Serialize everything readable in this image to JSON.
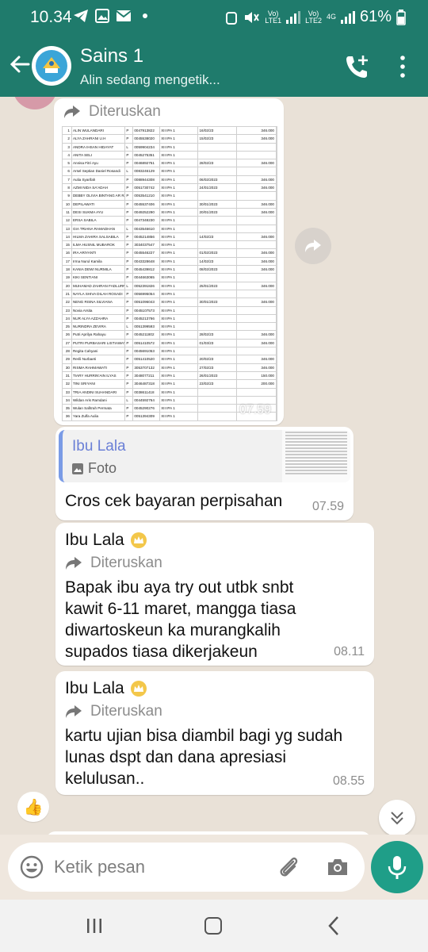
{
  "status_bar": {
    "time": "10.34",
    "battery": "61%",
    "lte1": "Vo)\nLTE1",
    "lte2": "Vo)\nLTE2",
    "network": "4G"
  },
  "header": {
    "title": "Sains 1",
    "subtitle": "Alin sedang mengetik..."
  },
  "messages": {
    "forwarded_label": "Diteruskan",
    "sheet_time": "07.59",
    "sheet_rows": [
      [
        "1",
        "ALIN WULANDARI",
        "P",
        "0047913822",
        "XII IPA 1",
        "16/02/23",
        "346.000"
      ],
      [
        "2",
        "ALYA ZAHRANI U.H",
        "P",
        "0045538020",
        "XII IPA 1",
        "15/02/23",
        "346.000"
      ],
      [
        "3",
        "ANDRA IHSAN HIDAYAT",
        "L",
        "0059904234",
        "XII IPA 1",
        "",
        ""
      ],
      [
        "4",
        "ANITA SELI",
        "P",
        "0045275351",
        "XII IPA 1",
        "",
        ""
      ],
      [
        "5",
        "Annisa Fitri Ayu",
        "P",
        "0046892751",
        "XII IPA 1",
        "28/02/23",
        "346.000"
      ],
      [
        "6",
        "Arsel Septian Daniel Rosandi",
        "L",
        "0083246129",
        "XII IPA 1",
        "",
        ""
      ],
      [
        "7",
        "Aulia Syarifah",
        "P",
        "0088944308",
        "XII IPA 1",
        "06/02/2023",
        "346.000"
      ],
      [
        "8",
        "AZMI NIDA SA'ADAH",
        "P",
        "0051730742",
        "XII IPA 1",
        "24/01/2023",
        "346.000"
      ],
      [
        "9",
        "DEBBY OLIVIA BINTANG AR RAFFA",
        "P",
        "0053541210",
        "XII IPA 1",
        "",
        ""
      ],
      [
        "10",
        "DEPILAWATI",
        "P",
        "0045537406",
        "XII IPA 1",
        "30/01/2023",
        "346.000"
      ],
      [
        "11",
        "DESI SUKMA AYU",
        "P",
        "0049252290",
        "XII IPA 1",
        "20/01/2023",
        "346.000"
      ],
      [
        "12",
        "ERSA SABILA",
        "P",
        "0047348230",
        "XII IPA 1",
        "",
        ""
      ],
      [
        "13",
        "GIA TRIANA RAMADHAN",
        "L",
        "0043546610",
        "XII IPA 1",
        "",
        ""
      ],
      [
        "14",
        "HILMA ZAHIRA SALSABILA",
        "P",
        "0045214856",
        "XII IPA 1",
        "14/02/23",
        "346.000"
      ],
      [
        "15",
        "ILMA HUSNIL MUBAROK",
        "P",
        "3034037547",
        "XII IPA 1",
        "",
        ""
      ],
      [
        "16",
        "IRA ARIYANTI",
        "P",
        "0045546227",
        "XII IPA 1",
        "01/02/2023",
        "346.000"
      ],
      [
        "17",
        "Irma Nurul Kamila",
        "P",
        "0043328648",
        "XII IPA 1",
        "14/02/23",
        "346.000"
      ],
      [
        "18",
        "KANIA DEWI NURMILA",
        "P",
        "0045439812",
        "XII IPA 1",
        "08/02/2023",
        "346.000"
      ],
      [
        "19",
        "KIKI SENTIANI",
        "P",
        "0044663065",
        "XII IPA 1",
        "",
        ""
      ],
      [
        "20",
        "MUHAMAD ZAHRAN FADLURROHIM",
        "L",
        "0052391826",
        "XII IPA 1",
        "25/01/2023",
        "346.000"
      ],
      [
        "21",
        "NAYLA SHIVA DILAH ROSADI",
        "P",
        "0056995054",
        "XII IPA 1",
        "",
        ""
      ],
      [
        "22",
        "NENG RISNA SILVIANA",
        "P",
        "0051096043",
        "XII IPA 1",
        "30/01/2023",
        "346.000"
      ],
      [
        "23",
        "Novia Arsita",
        "P",
        "0045107573",
        "XII IPA 1",
        "",
        ""
      ],
      [
        "24",
        "NUR ALYA AZZAHRA",
        "P",
        "0045213766",
        "XII IPA 1",
        "",
        ""
      ],
      [
        "25",
        "NURINDRA ZEVIRA",
        "L",
        "0051399593",
        "XII IPA 1",
        "",
        ""
      ],
      [
        "26",
        "Putri Aprilya Rahayu",
        "P",
        "0045211802",
        "XII IPA 1",
        "28/02/23",
        "346.000"
      ],
      [
        "27",
        "PUTRI PURBASARI LISTIAWATI",
        "P",
        "0051410572",
        "XII IPA 1",
        "01/03/23",
        "346.000"
      ],
      [
        "28",
        "Regita Cahyani",
        "P",
        "0045691053",
        "XII IPA 1",
        "",
        ""
      ],
      [
        "29",
        "Rerili Nurbaeti",
        "P",
        "0051410520",
        "XII IPA 1",
        "20/02/23",
        "346.000"
      ],
      [
        "30",
        "RISMA RAHMAWATI",
        "P",
        "3053707132",
        "XII IPA 1",
        "27/02/23",
        "346.000"
      ],
      [
        "31",
        "TIARY HURRIN'AIN ILYAS",
        "P",
        "3048077211",
        "XII IPA 1",
        "26/01/2023",
        "150.000"
      ],
      [
        "32",
        "TINI SRIYANI",
        "P",
        "3046487318",
        "XII IPA 1",
        "23/02/23",
        "200.000"
      ],
      [
        "33",
        "TRIA ANDINI SUHANDARI",
        "P",
        "0038611418",
        "XII IPA 1",
        "",
        ""
      ],
      [
        "34",
        "Wildan Aris Ramdani",
        "L",
        "0044592764",
        "XII IPA 1",
        "",
        ""
      ],
      [
        "35",
        "Wulan Safitrah Permata",
        "P",
        "0045290276",
        "XII IPA 1",
        "",
        ""
      ],
      [
        "36",
        "Yara Zulfa Aulia",
        "P",
        "0051394309",
        "XII IPA 1",
        "",
        ""
      ]
    ],
    "reply": {
      "quoted_name": "Ibu Lala",
      "quoted_type": "Foto",
      "text": "Cros cek bayaran perpisahan",
      "time": "07.59"
    },
    "msg1": {
      "sender": "Ibu Lala",
      "text": "Bapak ibu aya try out utbk snbt kawit 6-11 maret, mangga tiasa diwartoskeun ka murangkalih supados tiasa dikerjakeun",
      "time": "08.11"
    },
    "msg2": {
      "sender": "Ibu Lala",
      "text": "kartu ujian bisa diambil bagi yg sudah lunas dspt dan dana apresiasi kelulusan..",
      "time": "08.55"
    },
    "reaction": "👍"
  },
  "input": {
    "placeholder": "Ketik pesan"
  },
  "colors": {
    "header": "#1f7b6c",
    "mic": "#1f9e88",
    "chat_bg": "#e9e1d7"
  }
}
